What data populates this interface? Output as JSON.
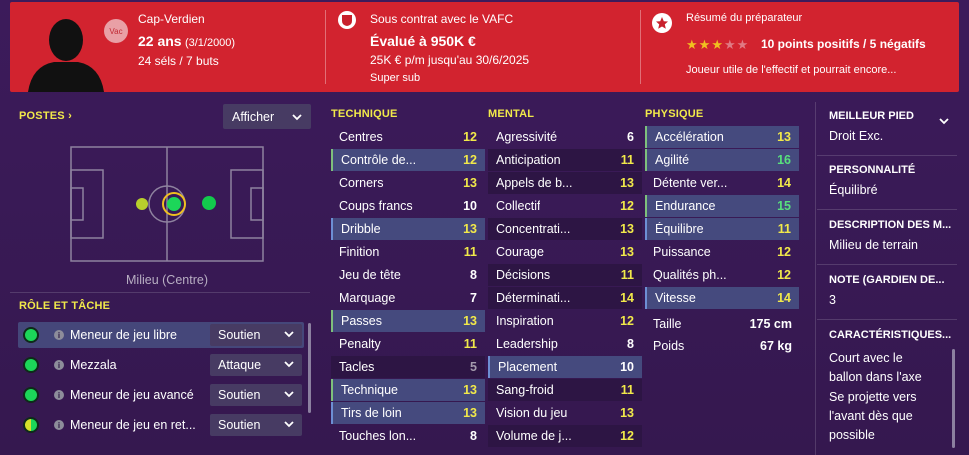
{
  "header": {
    "club_badge_label": "Vac",
    "nationality": "Cap-Verdien",
    "age": "22 ans",
    "dob": "(3/1/2000)",
    "caps": "24 séls / 7 buts",
    "contract": "Sous contrat avec le VAFC",
    "value": "Évalué à 950K €",
    "wage": "25K € p/m jusqu'au 30/6/2025",
    "squad_status": "Super sub",
    "report_title": "Résumé du préparateur",
    "report_summary": "10 points positifs / 5 négatifs",
    "report_text": "Joueur utile de l'effectif et pourrait encore...",
    "stars_filled": 3,
    "stars_total": 5
  },
  "positions": {
    "title": "POSTES",
    "show_button": "Afficher",
    "position_label": "Milieu (Centre)"
  },
  "roles": {
    "title": "RÔLE ET TÂCHE",
    "items": [
      {
        "name": "Meneur de jeu libre",
        "duty": "Soutien",
        "suitability": "full"
      },
      {
        "name": "Mezzala",
        "duty": "Attaque",
        "suitability": "full"
      },
      {
        "name": "Meneur de jeu avancé",
        "duty": "Soutien",
        "suitability": "full"
      },
      {
        "name": "Meneur de jeu en ret...",
        "duty": "Soutien",
        "suitability": "half"
      }
    ]
  },
  "technique": {
    "title": "TECHNIQUE",
    "attrs": [
      {
        "name": "Centres",
        "value": "12"
      },
      {
        "name": "Contrôle de...",
        "value": "12"
      },
      {
        "name": "Corners",
        "value": "13"
      },
      {
        "name": "Coups francs",
        "value": "10"
      },
      {
        "name": "Dribble",
        "value": "13"
      },
      {
        "name": "Finition",
        "value": "11"
      },
      {
        "name": "Jeu de tête",
        "value": "8"
      },
      {
        "name": "Marquage",
        "value": "7"
      },
      {
        "name": "Passes",
        "value": "13"
      },
      {
        "name": "Penalty",
        "value": "11"
      },
      {
        "name": "Tacles",
        "value": "5"
      },
      {
        "name": "Technique",
        "value": "13"
      },
      {
        "name": "Tirs de loin",
        "value": "13"
      },
      {
        "name": "Touches lon...",
        "value": "8"
      }
    ]
  },
  "mental": {
    "title": "MENTAL",
    "attrs": [
      {
        "name": "Agressivité",
        "value": "6"
      },
      {
        "name": "Anticipation",
        "value": "11"
      },
      {
        "name": "Appels de b...",
        "value": "13"
      },
      {
        "name": "Collectif",
        "value": "12"
      },
      {
        "name": "Concentrati...",
        "value": "13"
      },
      {
        "name": "Courage",
        "value": "13"
      },
      {
        "name": "Décisions",
        "value": "11"
      },
      {
        "name": "Déterminati...",
        "value": "14"
      },
      {
        "name": "Inspiration",
        "value": "12"
      },
      {
        "name": "Leadership",
        "value": "8"
      },
      {
        "name": "Placement",
        "value": "10"
      },
      {
        "name": "Sang-froid",
        "value": "11"
      },
      {
        "name": "Vision du jeu",
        "value": "13"
      },
      {
        "name": "Volume de j...",
        "value": "12"
      }
    ]
  },
  "physique": {
    "title": "PHYSIQUE",
    "attrs": [
      {
        "name": "Accélération",
        "value": "13"
      },
      {
        "name": "Agilité",
        "value": "16"
      },
      {
        "name": "Détente ver...",
        "value": "14"
      },
      {
        "name": "Endurance",
        "value": "15"
      },
      {
        "name": "Équilibre",
        "value": "11"
      },
      {
        "name": "Puissance",
        "value": "12"
      },
      {
        "name": "Qualités ph...",
        "value": "12"
      },
      {
        "name": "Vitesse",
        "value": "14"
      }
    ],
    "height_label": "Taille",
    "height_value": "175 cm",
    "weight_label": "Poids",
    "weight_value": "67 kg"
  },
  "info": {
    "foot_label": "MEILLEUR PIED",
    "foot_value": "Droit Exc.",
    "personality_label": "PERSONNALITÉ",
    "personality_value": "Équilibré",
    "description_label": "DESCRIPTION DES M...",
    "description_value": "Milieu de terrain",
    "gk_label": "NOTE (GARDIEN DE...",
    "gk_value": "3",
    "traits_label": "CARACTÉRISTIQUES...",
    "trait_1_line1": "Court avec le",
    "trait_1_line2": "ballon dans l'axe",
    "trait_2_line1": "Se projette vers",
    "trait_2_line2": "l'avant dès que",
    "trait_2_line3": "possible"
  },
  "colors": {
    "header_red": "#d2232f",
    "background": "#3a1a56",
    "attr_yellow": "#f1e94a",
    "attr_green": "#58e07d",
    "highlight_row": "#454a7e"
  }
}
